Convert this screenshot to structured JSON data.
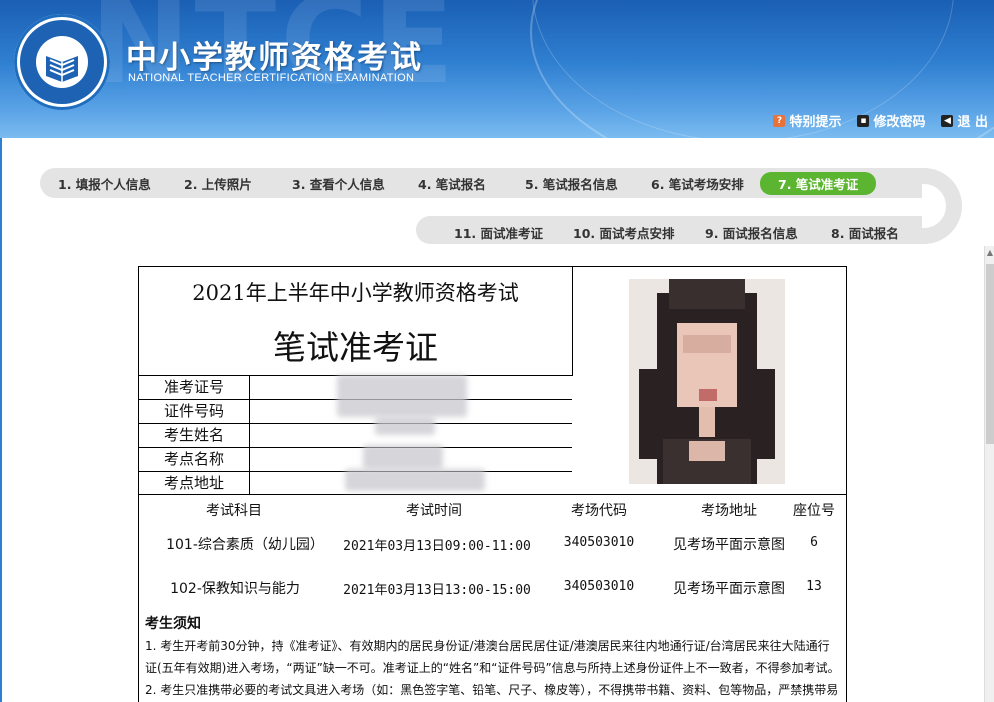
{
  "header": {
    "title_cn": "中小学教师资格考试",
    "title_en": "NATIONAL TEACHER CERTIFICATION EXAMINATION",
    "bg_text": "NTCE",
    "links": {
      "special_notice": "特别提示",
      "change_password": "修改密码",
      "logout": "退 出"
    }
  },
  "steps_row1": [
    {
      "label": "1. 填报个人信息"
    },
    {
      "label": "2. 上传照片"
    },
    {
      "label": "3. 查看个人信息"
    },
    {
      "label": "4. 笔试报名"
    },
    {
      "label": "5. 笔试报名信息"
    },
    {
      "label": "6. 笔试考场安排"
    },
    {
      "label": "7. 笔试准考证"
    }
  ],
  "steps_row2": [
    {
      "label": "11. 面试准考证"
    },
    {
      "label": "10. 面试考点安排"
    },
    {
      "label": "9. 面试报名信息"
    },
    {
      "label": "8. 面试报名"
    }
  ],
  "active_step": "7. 笔试准考证",
  "ticket": {
    "title1": "2021年上半年中小学教师资格考试",
    "title2": "笔试准考证",
    "fields": [
      {
        "label": "准考证号"
      },
      {
        "label": "证件号码"
      },
      {
        "label": "考生姓名"
      },
      {
        "label": "考点名称"
      },
      {
        "label": "考点地址"
      }
    ],
    "table_headers": [
      "考试科目",
      "考试时间",
      "考场代码",
      "考场地址",
      "座位号"
    ],
    "rows": [
      {
        "subject": "101-综合素质（幼儿园）",
        "time": "2021年03月13日09:00-11:00",
        "room_code": "340503010",
        "room_addr": "见考场平面示意图",
        "seat": "6"
      },
      {
        "subject": "102-保教知识与能力",
        "time": "2021年03月13日13:00-15:00",
        "room_code": "340503010",
        "room_addr": "见考场平面示意图",
        "seat": "13"
      }
    ],
    "notice_title": "考生须知",
    "notice_text": "1. 考生开考前30分钟，持《准考证》、有效期内的居民身份证/港澳台居民居住证/港澳居民来往内地通行证/台湾居民来往大陆通行证(五年有效期)进入考场，“两证”缺一不可。准考证上的“姓名”和“证件号码”信息与所持上述身份证件上不一致者，不得参加考试。",
    "notice_text2": "2. 考生只准携带必要的考试文具进入考场（如：黑色签字笔、铅笔、尺子、橡皮等），不得携带书籍、资料、包等物品，严禁携带易"
  },
  "colors": {
    "header_blue": "#1a5fb4",
    "active_step": "#5cb531",
    "nav_track": "#e4e4e4"
  }
}
